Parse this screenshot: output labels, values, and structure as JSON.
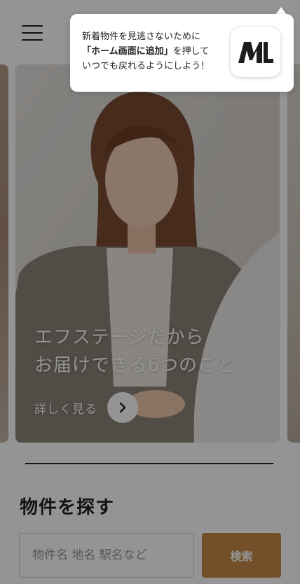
{
  "header": {
    "menu_icon": "hamburger-menu-icon"
  },
  "hero": {
    "title_line1": "エフステージだから",
    "title_line2": "お届けできる6つのこと",
    "detail_label": "詳しく見る",
    "detail_icon": "chevron-right-icon"
  },
  "search": {
    "heading": "物件を探す",
    "placeholder": "物件名 地名 駅名など",
    "button_label": "検索"
  },
  "tooltip": {
    "line1": "新着物件を見逃さないために",
    "line2_bold": "「ホーム画面に追加」",
    "line2_rest": "を押して",
    "line3": "いつでも戻れるようにしよう！",
    "app_icon": "ml-logo-icon"
  },
  "colors": {
    "accent": "#c78a48",
    "overlay": "rgba(0,0,0,0.42)",
    "text": "#222222"
  }
}
